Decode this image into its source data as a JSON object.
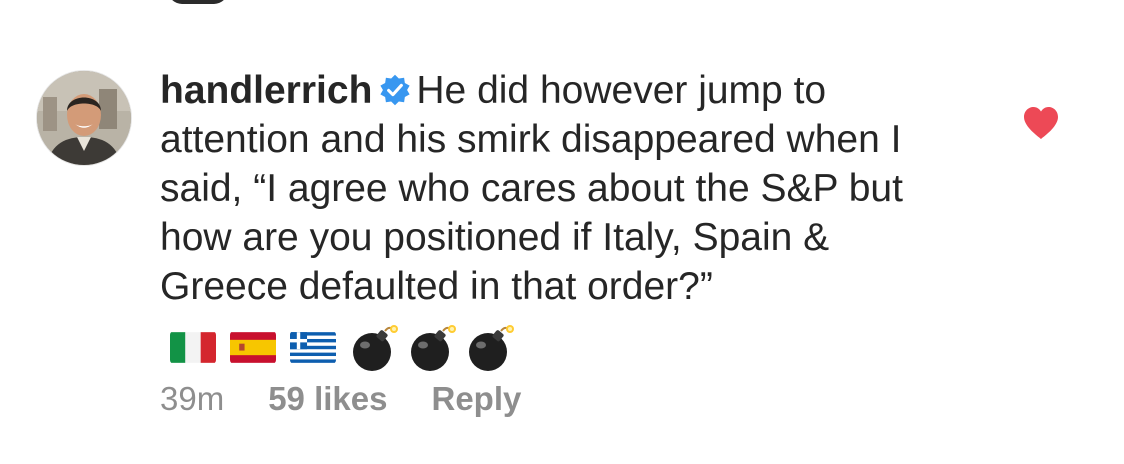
{
  "comment": {
    "username": "handlerrich",
    "verified_icon": "verified-badge-icon",
    "text": "He did however jump to attention and his smirk disappeared when I said, “I agree who cares about the S&P but how are you positioned  if Italy, Spain & Greece defaulted in that order?”",
    "emojis": [
      "flag-italy-icon",
      "flag-spain-icon",
      "flag-greece-icon",
      "bomb-icon",
      "bomb-icon",
      "bomb-icon"
    ],
    "time": "39m",
    "likes": "59 likes",
    "reply_label": "Reply",
    "like_icon": "heart-icon",
    "liked": true
  },
  "colors": {
    "text": "#262626",
    "meta": "#8e8e8e",
    "verified": "#3897f0",
    "heart": "#ed4956"
  }
}
